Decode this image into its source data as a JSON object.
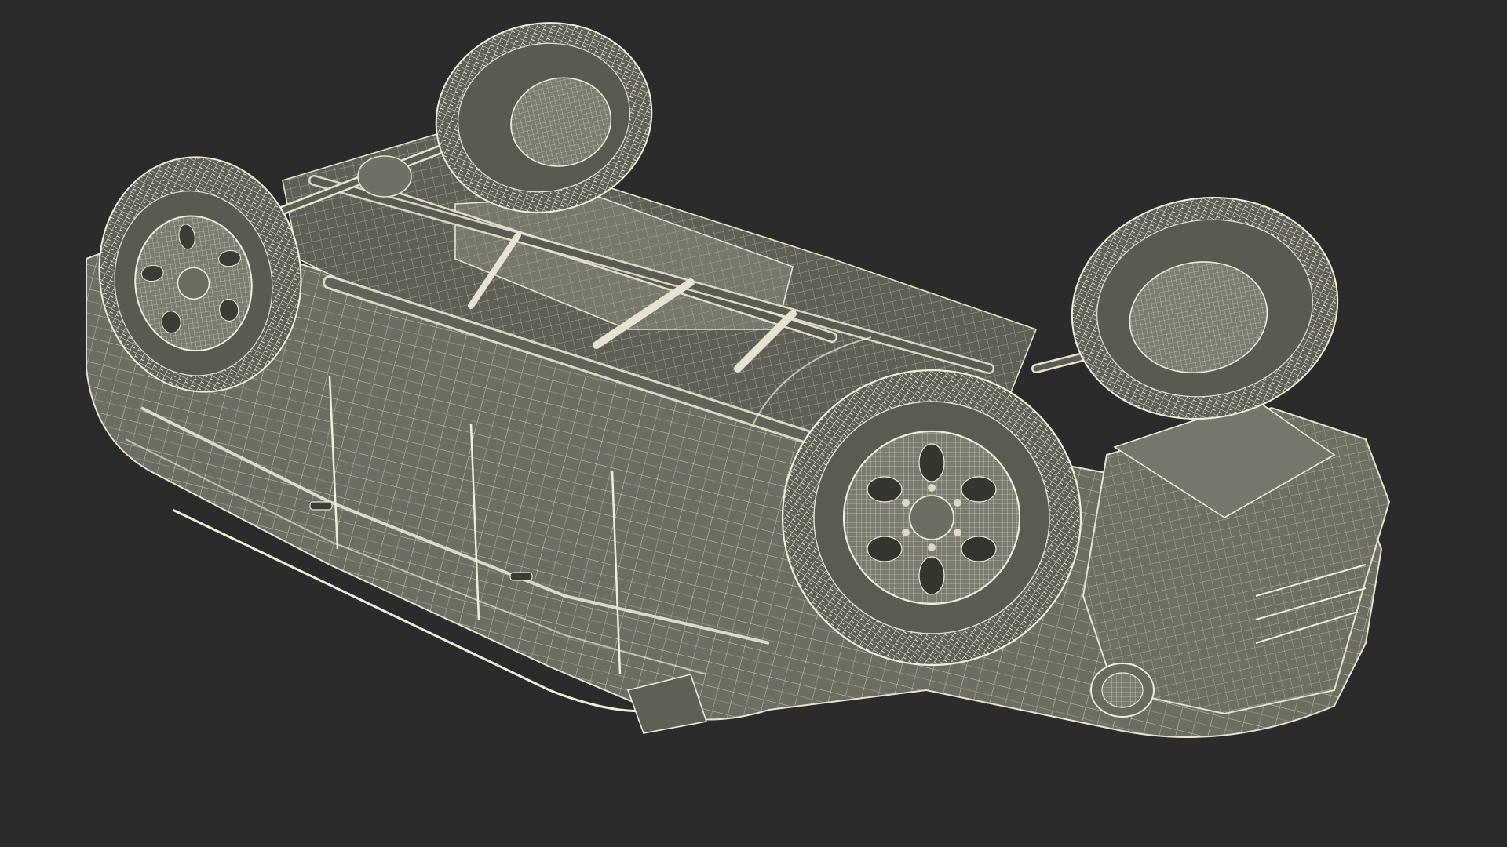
{
  "scene": {
    "subject": "vehicle-wireframe-upside-down",
    "colors": {
      "background": "#2b2b2b",
      "body_fill": "#6f6f66",
      "body_dark": "#4e4e47",
      "body_shadow": "#3a3a35",
      "wire": "#e6e3d2",
      "wire_dim": "#b9b6a6",
      "tire_fill": "#5d5d56",
      "rim_fill": "#7a7a70"
    }
  }
}
